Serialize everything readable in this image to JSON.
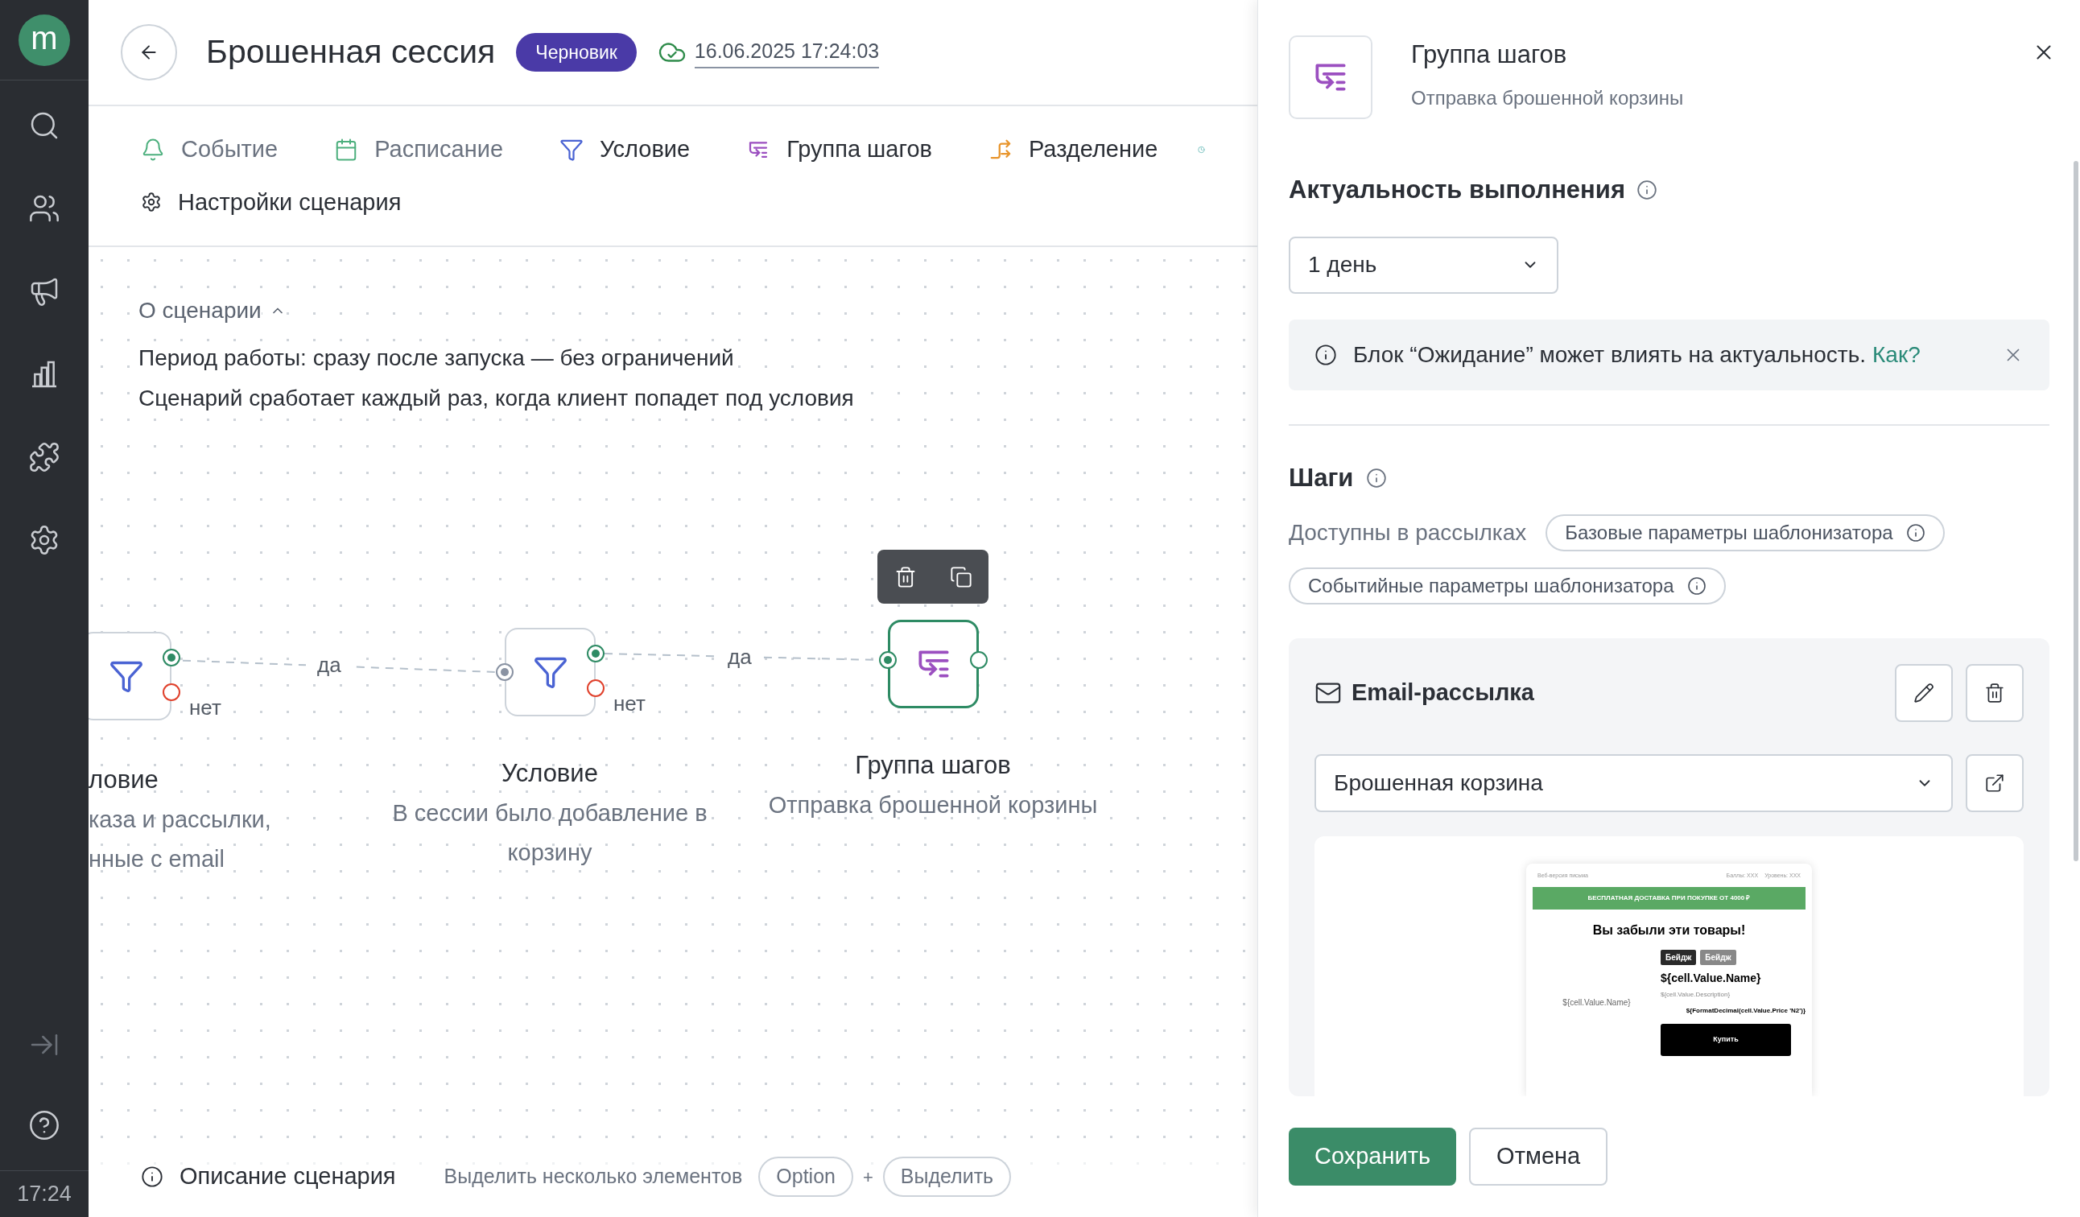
{
  "sidebar": {
    "logo": "m",
    "clock": "17:24"
  },
  "header": {
    "title": "Брошенная сессия",
    "status": "Черновик",
    "saved_at": "16.06.2025 17:24:03"
  },
  "toolbar": {
    "items": [
      {
        "kind": "event",
        "label": "Событие",
        "disabled": true
      },
      {
        "kind": "schedule",
        "label": "Расписание",
        "disabled": true
      },
      {
        "kind": "condition",
        "label": "Условие",
        "disabled": false
      },
      {
        "kind": "group",
        "label": "Группа шагов",
        "disabled": false
      },
      {
        "kind": "split",
        "label": "Разделение",
        "disabled": false
      }
    ],
    "settings_label": "Настройки сценария"
  },
  "about": {
    "title": "О сценарии",
    "expanded": true,
    "lines": [
      "Период работы: сразу после запуска — без ограничений",
      "Сценарий сработает каждый раз, когда клиент попадет под условия"
    ]
  },
  "canvas": {
    "nodes": [
      {
        "kind": "condition",
        "title": "ловие",
        "description": [
          "каза и рассылки,",
          "нные с email"
        ],
        "no_label": "нет",
        "selected": false
      },
      {
        "kind": "condition",
        "title": "Условие",
        "description": [
          "В сессии было добавление в",
          "корзину"
        ],
        "no_label": "нет",
        "selected": false
      },
      {
        "kind": "group",
        "title": "Группа шагов",
        "description": [
          "Отправка брошенной корзины"
        ],
        "selected": true
      }
    ],
    "edges": [
      {
        "label": "да"
      },
      {
        "label": "да"
      }
    ]
  },
  "bottom_bar": {
    "description": "Описание сценария",
    "hint": "Выделить несколько элементов",
    "keys": [
      "Option",
      "Выделить"
    ],
    "plus": "+"
  },
  "panel": {
    "title": "Группа шагов",
    "subtitle": "Отправка брошенной корзины",
    "relevance": {
      "label": "Актуальность выполнения",
      "value": "1 день"
    },
    "notice": {
      "text": "Блок “Ожидание” может влиять на актуальность.",
      "link": "Как?"
    },
    "steps": {
      "title": "Шаги",
      "available_label": "Доступны в рассылках",
      "chips": [
        "Базовые параметры шаблонизатора",
        "Событийные параметры шаблонизатора"
      ]
    },
    "step_card": {
      "title": "Email-рассылка",
      "template": "Брошенная корзина",
      "preview": {
        "web_version": "Веб-версия письма",
        "points": "Баллы: XXX",
        "level": "Уровень: XXX",
        "banner": "БЕСПЛАТНАЯ ДОСТАВКА ПРИ ПОКУПКЕ ОТ 4000 ₽",
        "heading": "Вы забыли эти товары!",
        "image_alt": "${cell.Value.Name}",
        "badges": [
          "Бейдж",
          "Бейдж"
        ],
        "name": "${cell.Value.Name}",
        "description": "${cell.Value.Description}",
        "price": "${FormatDecimal(cell.Value.Price 'N2')}",
        "button": "Купить"
      }
    }
  },
  "buttons": {
    "save": "Сохранить",
    "cancel": "Отмена"
  }
}
